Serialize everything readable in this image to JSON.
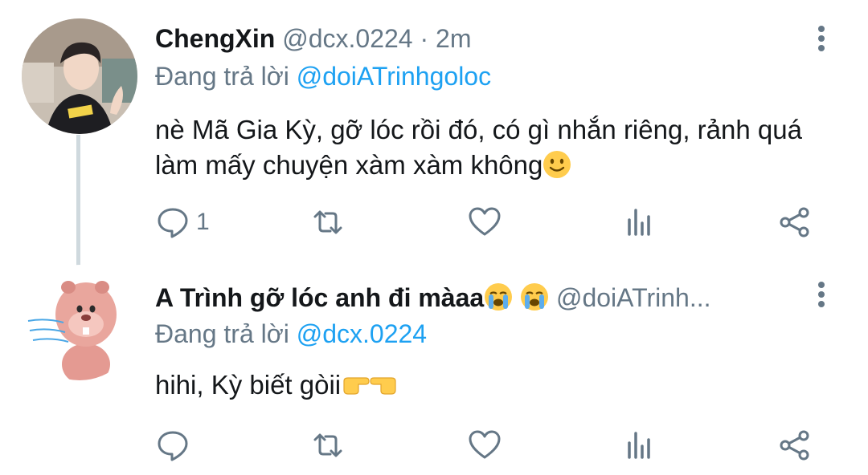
{
  "colors": {
    "accent": "#1da1f2",
    "secondary_text": "#657786",
    "primary_text": "#14171a",
    "thread_line": "#cfd9de"
  },
  "tweets": [
    {
      "avatar_icon": "person-photo",
      "name": "ChengXin",
      "handle": "@dcx.0224",
      "separator": "·",
      "time": "2m",
      "replying_label": "Đang trả lời",
      "replying_to": "@doiATrinhgoloc",
      "text": "nè Mã Gia Kỳ, gỡ lóc rồi đó, có gì nhắn riêng, rảnh quá làm mấy chuyện xàm xàm không",
      "text_emoji": "slightly-smiling-face",
      "reply_count": "1"
    },
    {
      "avatar_icon": "pink-beaver",
      "name": "A Trình gỡ lóc anh đi màaa",
      "name_emojis": [
        "loudly-crying-face",
        "loudly-crying-face"
      ],
      "handle": "@doiATrinh...",
      "replying_label": "Đang trả lời",
      "replying_to": "@dcx.0224",
      "text": "hihi, Kỳ biết gòii",
      "text_emojis": [
        "pointing-right-hand",
        "pointing-left-hand"
      ],
      "reply_count": ""
    }
  ]
}
